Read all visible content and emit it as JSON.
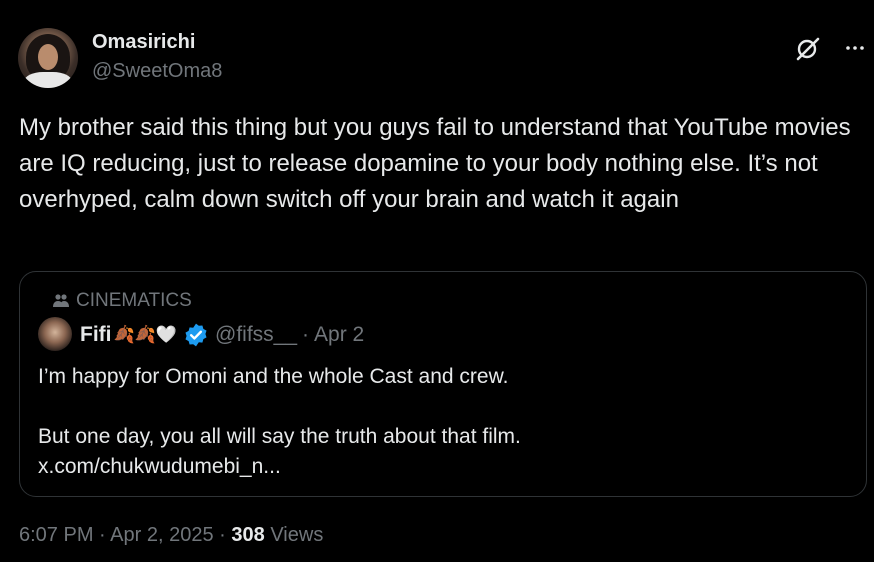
{
  "author": {
    "name": "Omasirichi",
    "handle": "@SweetOma8"
  },
  "tweet": {
    "text": "My brother said this thing but you guys fail to understand that YouTube movies are IQ reducing, just to release dopamine to your body nothing else. It’s not overhyped, calm down switch off your brain and watch it again"
  },
  "quoted": {
    "community": "CINEMATICS",
    "name": "Fifi",
    "emoji": "🍂🍂🤍",
    "handle": "@fifss__",
    "separator": "·",
    "date": "Apr 2",
    "line1": "I’m happy for Omoni and the whole Cast and crew.",
    "line2": "But one day, you all  will say the truth about that film.",
    "link": "x.com/chukwudumebi_n..."
  },
  "meta": {
    "time": "6:07 PM",
    "separator": "·",
    "date": "Apr 2, 2025",
    "views_count": "308",
    "views_label": "Views"
  },
  "icons": {
    "grok": "grok-icon",
    "more": "more-icon",
    "community": "community-icon",
    "verified": "verified-badge-icon"
  },
  "colors": {
    "background": "#000000",
    "text": "#e7e9ea",
    "secondary": "#71767b",
    "border": "#2f3336",
    "verified": "#1d9bf0"
  }
}
